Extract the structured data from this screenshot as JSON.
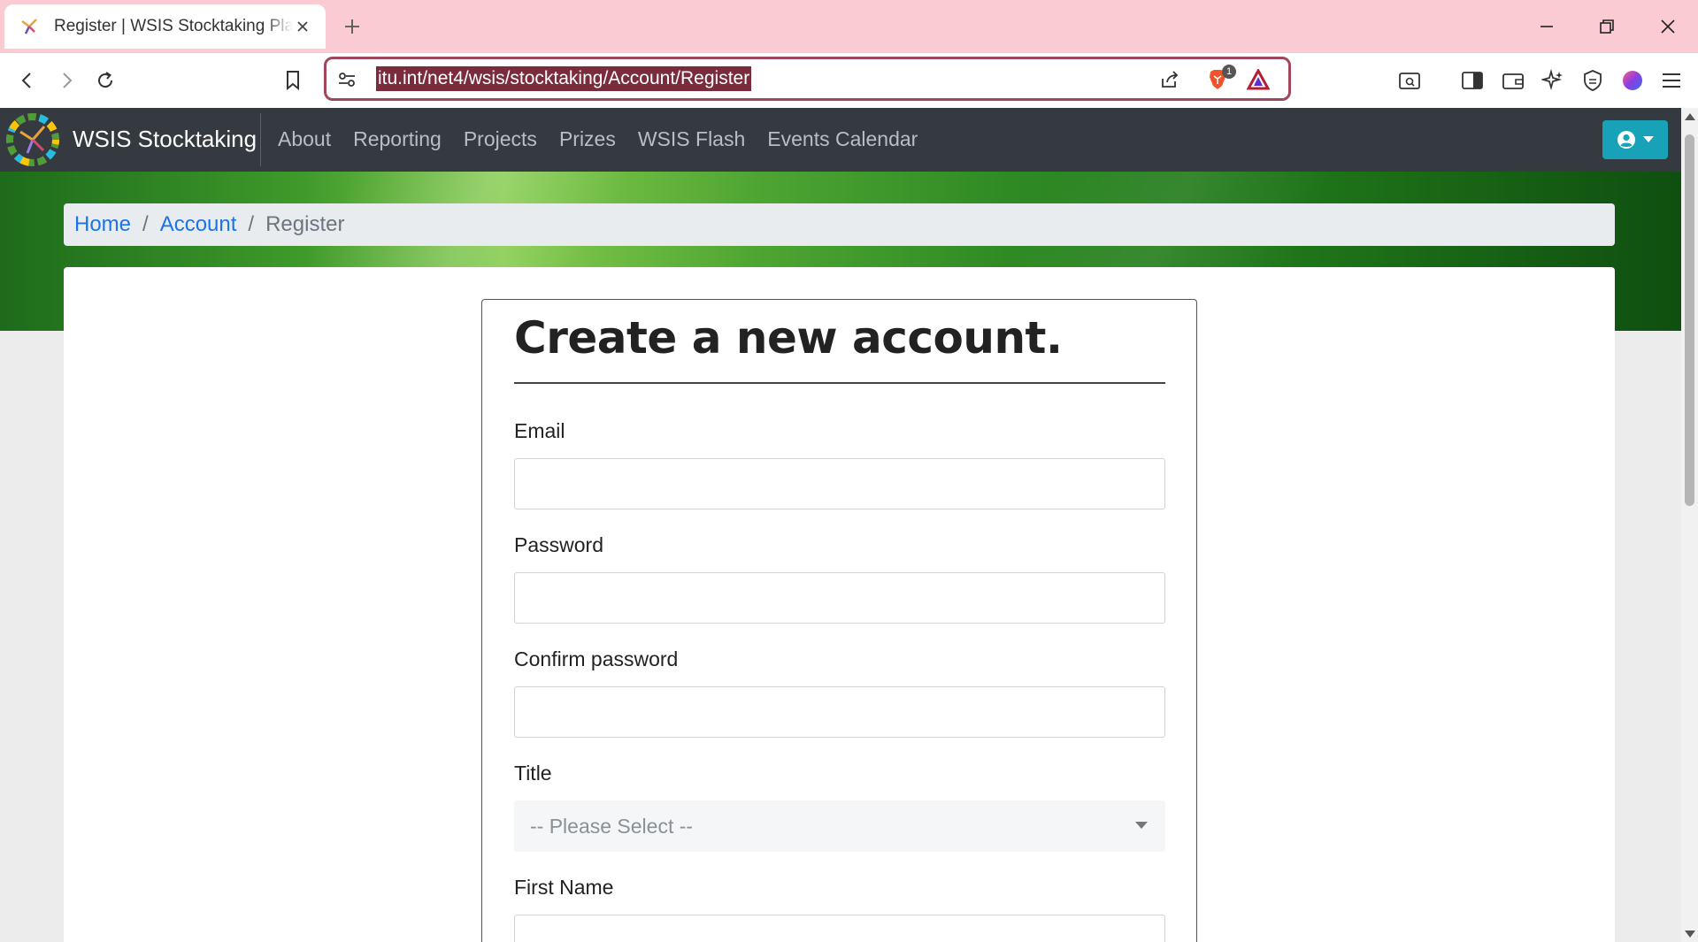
{
  "browser": {
    "tab": {
      "title": "Register | WSIS Stocktaking Platform"
    },
    "address_bar": {
      "url": "itu.int/net4/wsis/stocktaking/Account/Register"
    },
    "shields_badge": "1"
  },
  "site": {
    "brand": "WSIS Stocktaking",
    "nav": [
      {
        "label": "About"
      },
      {
        "label": "Reporting"
      },
      {
        "label": "Projects"
      },
      {
        "label": "Prizes"
      },
      {
        "label": "WSIS Flash"
      },
      {
        "label": "Events Calendar"
      }
    ]
  },
  "breadcrumb": {
    "home": "Home",
    "account": "Account",
    "separator": "/",
    "current": "Register"
  },
  "form": {
    "title": "Create a new account.",
    "fields": {
      "email": {
        "label": "Email",
        "value": ""
      },
      "password": {
        "label": "Password",
        "value": ""
      },
      "confirm_password": {
        "label": "Confirm password",
        "value": ""
      },
      "title": {
        "label": "Title",
        "selected": "-- Please Select --"
      },
      "first_name": {
        "label": "First Name",
        "value": ""
      }
    }
  },
  "colors": {
    "tabstrip": "#fbcbd3",
    "navbar": "#343a40",
    "user_button": "#17a2b8",
    "link": "#1a73e8",
    "omnibox_border": "#a0475b"
  }
}
